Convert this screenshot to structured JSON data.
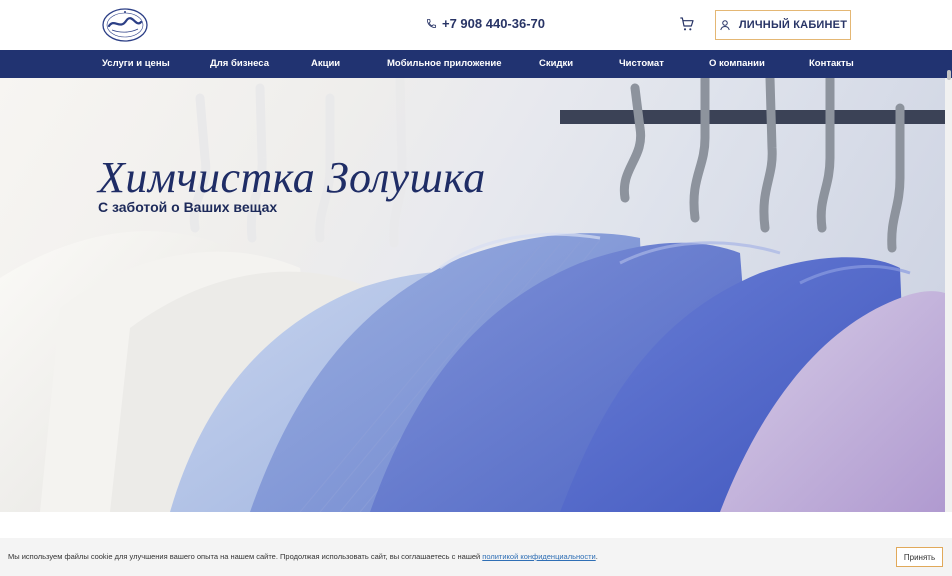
{
  "header": {
    "logo_icon": "zolushka-logo",
    "phone": "+7 908 440-36-70",
    "phone_icon": "phone-icon",
    "cart_icon": "cart-icon",
    "cabinet_label": "ЛИЧНЫЙ КАБИНЕТ",
    "cabinet_icon": "user-icon",
    "accent_color": "#e4b774"
  },
  "nav": {
    "background": "#213371",
    "items": [
      {
        "label": "Услуги и цены"
      },
      {
        "label": "Для бизнеса"
      },
      {
        "label": "Акции"
      },
      {
        "label": "Мобильное приложение"
      },
      {
        "label": "Скидки"
      },
      {
        "label": "Чистомат"
      },
      {
        "label": "О компании"
      },
      {
        "label": "Контакты"
      }
    ]
  },
  "hero": {
    "title": "Химчистка Золушка",
    "subtitle": "С заботой о Ваших вещах"
  },
  "cookie": {
    "text": "Мы используем файлы cookie для улучшения вашего опыта на нашем сайте. Продолжая использовать сайт, вы соглашаетесь с нашей ",
    "link": "политикой конфиденциальности",
    "text_end": ".",
    "accept_label": "Принять"
  }
}
